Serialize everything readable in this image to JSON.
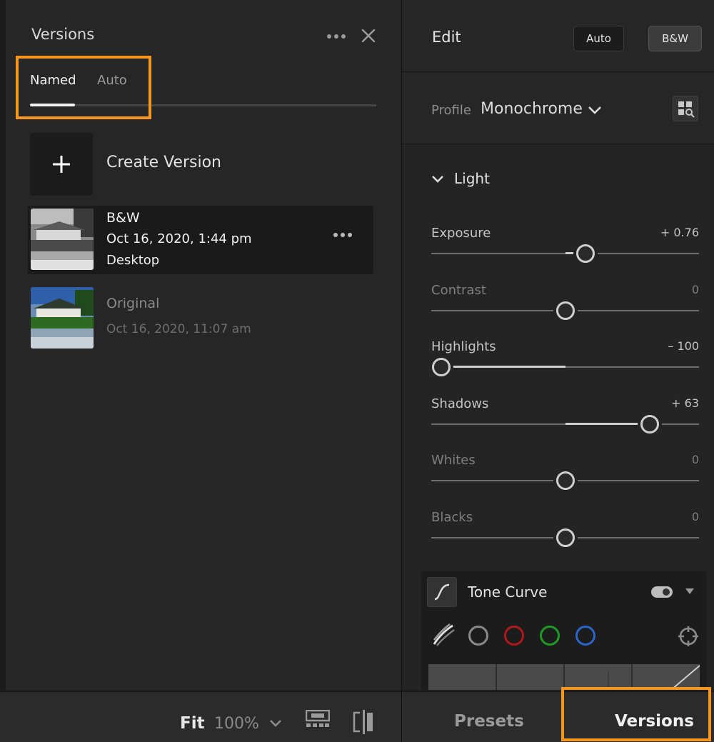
{
  "versions_panel": {
    "title": "Versions",
    "tabs": [
      {
        "label": "Named",
        "active": true
      },
      {
        "label": "Auto",
        "active": false
      }
    ],
    "create_label": "Create Version",
    "items": [
      {
        "name": "B&W",
        "date": "Oct 16, 2020, 1:44 pm",
        "source": "Desktop",
        "selected": true
      },
      {
        "name": "Original",
        "date": "Oct 16, 2020, 11:07 am",
        "source": "",
        "selected": false
      }
    ]
  },
  "bottom_toolbar": {
    "fit_label": "Fit",
    "zoom_label": "100%"
  },
  "edit_panel": {
    "title": "Edit",
    "auto_button": "Auto",
    "bw_button": "B&W",
    "profile_label": "Profile",
    "profile_value": "Monochrome",
    "light_section": "Light",
    "sliders": [
      {
        "label": "Exposure",
        "value_text": "+ 0.76",
        "value": 0.76,
        "min": -5,
        "max": 5
      },
      {
        "label": "Contrast",
        "value_text": "0",
        "value": 0,
        "min": -100,
        "max": 100
      },
      {
        "label": "Highlights",
        "value_text": "– 100",
        "value": -100,
        "min": -100,
        "max": 100
      },
      {
        "label": "Shadows",
        "value_text": "+ 63",
        "value": 63,
        "min": -100,
        "max": 100
      },
      {
        "label": "Whites",
        "value_text": "0",
        "value": 0,
        "min": -100,
        "max": 100
      },
      {
        "label": "Blacks",
        "value_text": "0",
        "value": 0,
        "min": -100,
        "max": 100
      }
    ],
    "tone_curve": {
      "title": "Tone Curve",
      "enabled": true,
      "channels": [
        {
          "name": "rgb-icon",
          "color": "#8a8a8a"
        },
        {
          "name": "red-channel-icon",
          "color": "#b0181c"
        },
        {
          "name": "green-channel-icon",
          "color": "#1e9a24"
        },
        {
          "name": "blue-channel-icon",
          "color": "#2a66c8"
        }
      ]
    }
  },
  "bottom_tabs": {
    "presets": "Presets",
    "versions": "Versions"
  },
  "accent_color": "#f5961e"
}
